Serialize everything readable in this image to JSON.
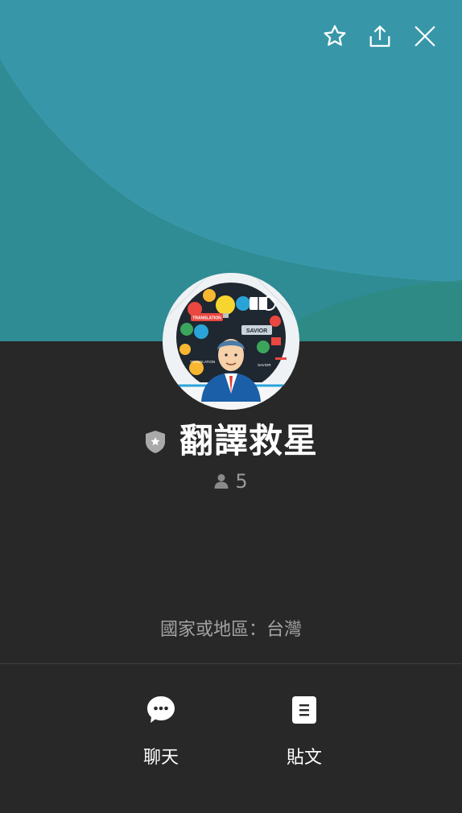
{
  "header": {
    "actions": [
      {
        "icon": "star-icon",
        "name": "favorite"
      },
      {
        "icon": "share-icon",
        "name": "share"
      },
      {
        "icon": "close-icon",
        "name": "close"
      }
    ]
  },
  "cover": {
    "colors": {
      "base": "#2f8b94",
      "light": "#3a97a6",
      "accent": "#2e8c80"
    }
  },
  "profile": {
    "avatar_icon": "translation-savior-avatar",
    "avatar_texts": [
      "TRANSLATION",
      "SAVIOR"
    ],
    "badge_icon": "shield-star-icon",
    "title": "翻譯救星",
    "member_icon": "person-icon",
    "member_count": "5",
    "region": "國家或地區：台灣"
  },
  "bottom_actions": {
    "chat": {
      "label": "聊天",
      "icon": "chat-bubble-icon"
    },
    "post": {
      "label": "貼文",
      "icon": "document-icon"
    }
  },
  "colors": {
    "background": "#282828",
    "text_primary": "#ffffff",
    "text_secondary": "#a3a3a3",
    "divider": "#3d3d3d"
  }
}
